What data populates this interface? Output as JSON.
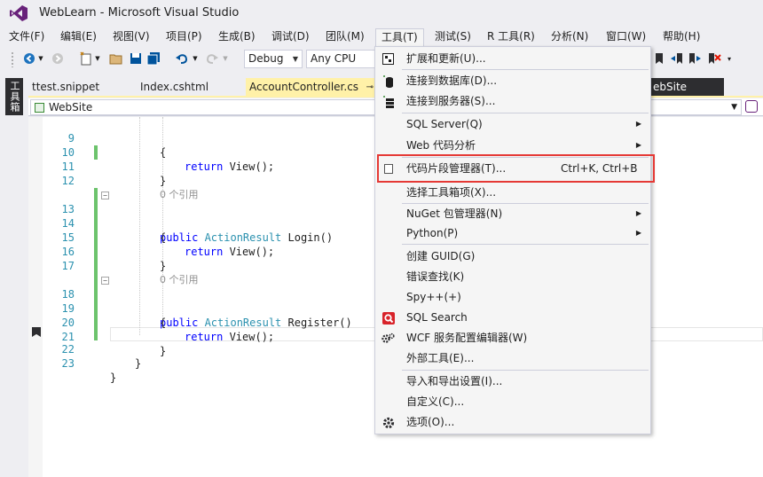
{
  "window": {
    "title": "WebLearn - Microsoft Visual Studio"
  },
  "menubar": {
    "items": [
      "文件(F)",
      "编辑(E)",
      "视图(V)",
      "项目(P)",
      "生成(B)",
      "调试(D)",
      "团队(M)",
      "工具(T)",
      "测试(S)",
      "R 工具(R)",
      "分析(N)",
      "窗口(W)",
      "帮助(H)"
    ],
    "active_index": 7
  },
  "toolbar": {
    "config": "Debug",
    "platform": "Any CPU"
  },
  "toolbox": {
    "label": "工具箱"
  },
  "tabs": [
    {
      "label": "ttest.snippet",
      "state": "plain"
    },
    {
      "label": "Index.cshtml",
      "state": "plain"
    },
    {
      "label": "AccountController.cs",
      "state": "active",
      "pin": "⊸"
    },
    {
      "label": "ebSite",
      "state": "dark"
    }
  ],
  "navbar": {
    "project": "WebSite"
  },
  "editor": {
    "lines": [
      {
        "n": "9",
        "text": "{"
      },
      {
        "n": "10",
        "text": "return View();"
      },
      {
        "n": "11",
        "text": "}"
      },
      {
        "n": "12",
        "text": ""
      },
      {
        "n": "",
        "text": "0 个引用"
      },
      {
        "n": "13",
        "text": "public ActionResult Login()"
      },
      {
        "n": "14",
        "text": "{"
      },
      {
        "n": "15",
        "text": "return View();"
      },
      {
        "n": "16",
        "text": "}"
      },
      {
        "n": "17",
        "text": ""
      },
      {
        "n": "",
        "text": "0 个引用"
      },
      {
        "n": "18",
        "text": "public ActionResult Register()"
      },
      {
        "n": "19",
        "text": "{"
      },
      {
        "n": "20",
        "text": "return View();"
      },
      {
        "n": "21",
        "text": "}"
      },
      {
        "n": "22",
        "text": "}"
      },
      {
        "n": "23",
        "text": "}"
      }
    ]
  },
  "tools_menu": {
    "items": [
      {
        "label": "扩展和更新(U)...",
        "icon": "extensions-icon"
      },
      {
        "label": "连接到数据库(D)...",
        "icon": "database-connect-icon"
      },
      {
        "label": "连接到服务器(S)...",
        "icon": "server-connect-icon"
      },
      {
        "label": "SQL Server(Q)",
        "submenu": true
      },
      {
        "label": "Web 代码分析",
        "submenu": true
      },
      {
        "label": "代码片段管理器(T)...",
        "shortcut": "Ctrl+K, Ctrl+B",
        "icon": "checkbox-icon",
        "highlighted": true
      },
      {
        "label": "选择工具箱项(X)..."
      },
      {
        "label": "NuGet 包管理器(N)",
        "submenu": true
      },
      {
        "label": "Python(P)",
        "submenu": true
      },
      {
        "label": "创建 GUID(G)"
      },
      {
        "label": "错误查找(K)"
      },
      {
        "label": "Spy++(+)"
      },
      {
        "label": "SQL Search",
        "icon": "sql-search-icon"
      },
      {
        "label": "WCF 服务配置编辑器(W)",
        "icon": "gears-icon"
      },
      {
        "label": "外部工具(E)..."
      },
      {
        "label": "导入和导出设置(I)..."
      },
      {
        "label": "自定义(C)..."
      },
      {
        "label": "选项(O)...",
        "icon": "gear-icon"
      }
    ]
  }
}
